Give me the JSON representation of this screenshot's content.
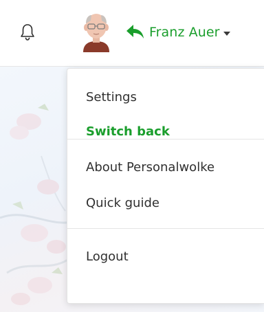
{
  "header": {
    "user_name": "Franz Auer",
    "accent_color": "#1a9e2c",
    "icons": {
      "notifications": "bell-icon",
      "avatar": "avatar",
      "switch_user": "switch-back-arrow-icon",
      "menu_toggle": "caret-down-icon"
    }
  },
  "menu": {
    "settings": "Settings",
    "switch_back": "Switch back",
    "about": "About Personalwolke",
    "quick_guide": "Quick guide",
    "logout": "Logout"
  }
}
